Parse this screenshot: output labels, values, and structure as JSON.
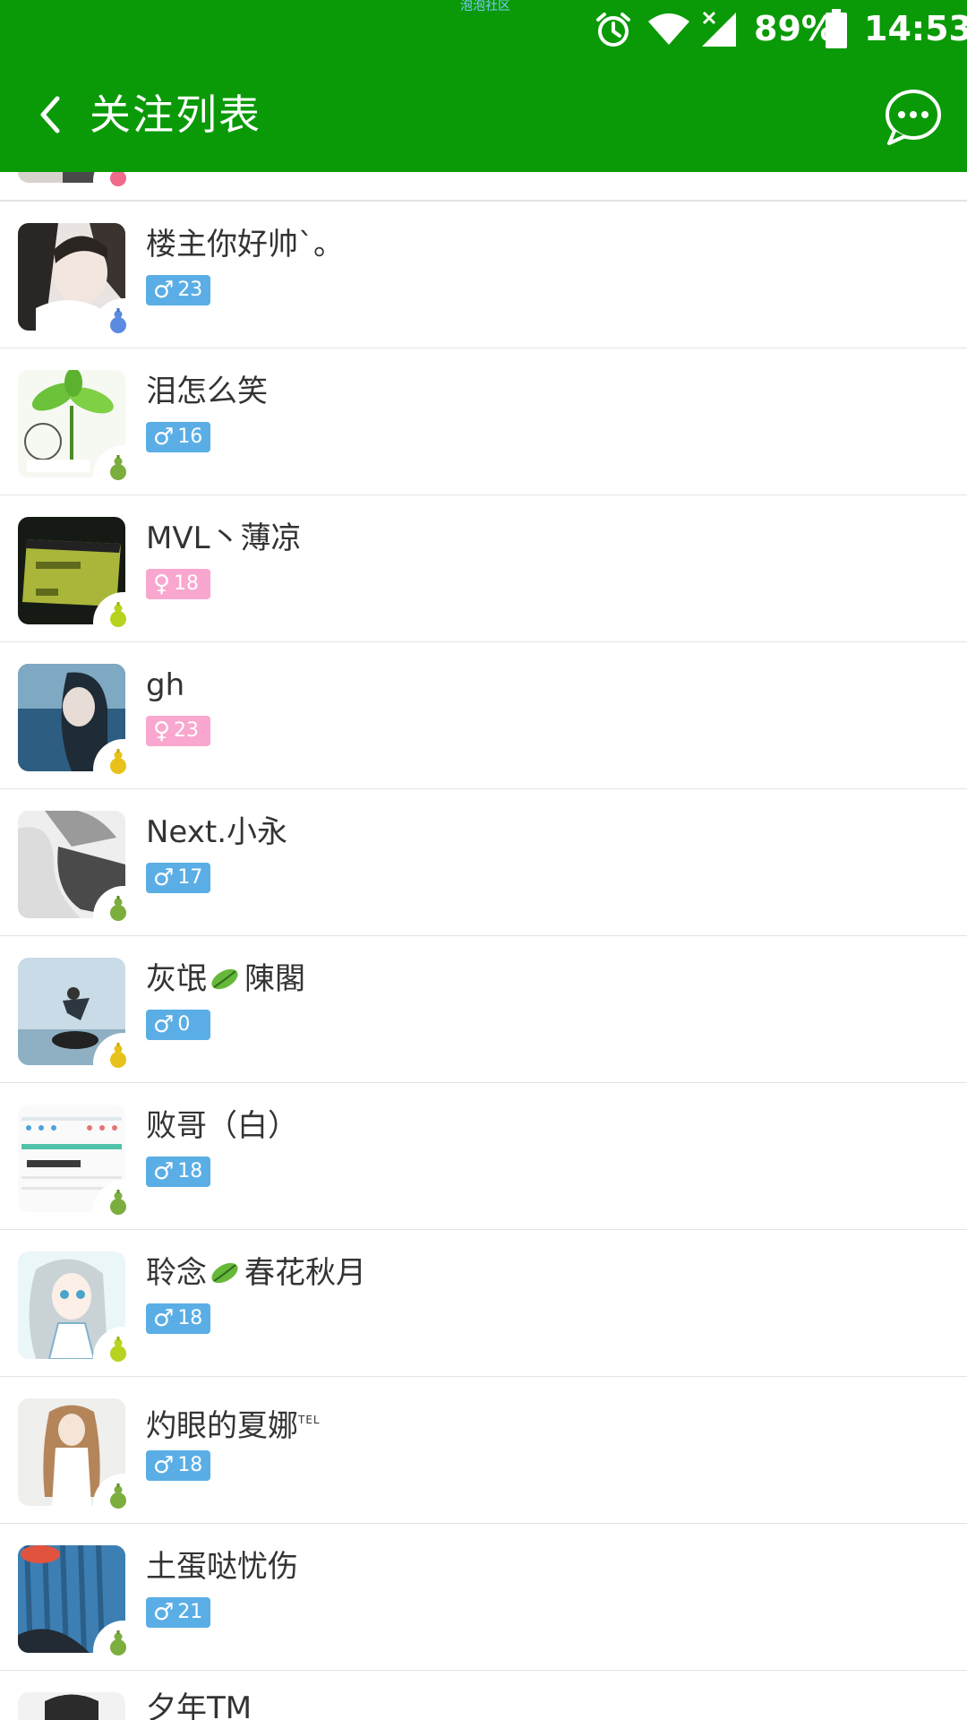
{
  "status_bar": {
    "app_label": "泡泡社区",
    "battery_percent": "89%",
    "time": "14:53",
    "icons": [
      "alarm-icon",
      "wifi-icon",
      "no-signal-icon",
      "battery-icon"
    ]
  },
  "header": {
    "title": "关注列表",
    "back_icon": "chevron-left-icon",
    "message_icon": "chat-bubble-icon",
    "background_color": "#0a9a07"
  },
  "follow_list": [
    {
      "name": "",
      "gender": "",
      "age": "",
      "gourd_color": "#f06a8a",
      "partial": "top"
    },
    {
      "name": "楼主你好帅`。",
      "gender": "male",
      "age": "23",
      "gourd_color": "#5b8be0"
    },
    {
      "name": "泪怎么笑",
      "gender": "male",
      "age": "16",
      "gourd_color": "#7cae3e"
    },
    {
      "name": "MVL丶薄凉",
      "gender": "female",
      "age": "18",
      "gourd_color": "#b8d21f"
    },
    {
      "name": "gh",
      "gender": "female",
      "age": "23",
      "gourd_color": "#e8c21a"
    },
    {
      "name": "Next.小永",
      "gender": "male",
      "age": "17",
      "gourd_color": "#7cae3e"
    },
    {
      "name": "灰氓",
      "name_suffix": "陳閣",
      "has_leaf": true,
      "gender": "male",
      "age": "0",
      "gourd_color": "#e8c21a"
    },
    {
      "name": "败哥（白）",
      "gender": "male",
      "age": "18",
      "gourd_color": "#7cae3e"
    },
    {
      "name": "聆念",
      "name_suffix": "春花秋月",
      "has_leaf": true,
      "gender": "male",
      "age": "18",
      "gourd_color": "#b8d21f"
    },
    {
      "name": "灼眼的夏娜",
      "name_sup": "TEL",
      "gender": "male",
      "age": "18",
      "gourd_color": "#7cae3e"
    },
    {
      "name": "土蛋哒忧伤",
      "gender": "male",
      "age": "21",
      "gourd_color": "#7cae3e"
    },
    {
      "name": "夕年TM",
      "gender": "",
      "age": "",
      "gourd_color": "",
      "partial": "bottom"
    }
  ],
  "gender_symbols": {
    "male": "♂",
    "female": "♀"
  },
  "colors": {
    "male_badge": "#5aaee5",
    "female_badge": "#f9a7cf",
    "divider": "#e3e3e3"
  }
}
